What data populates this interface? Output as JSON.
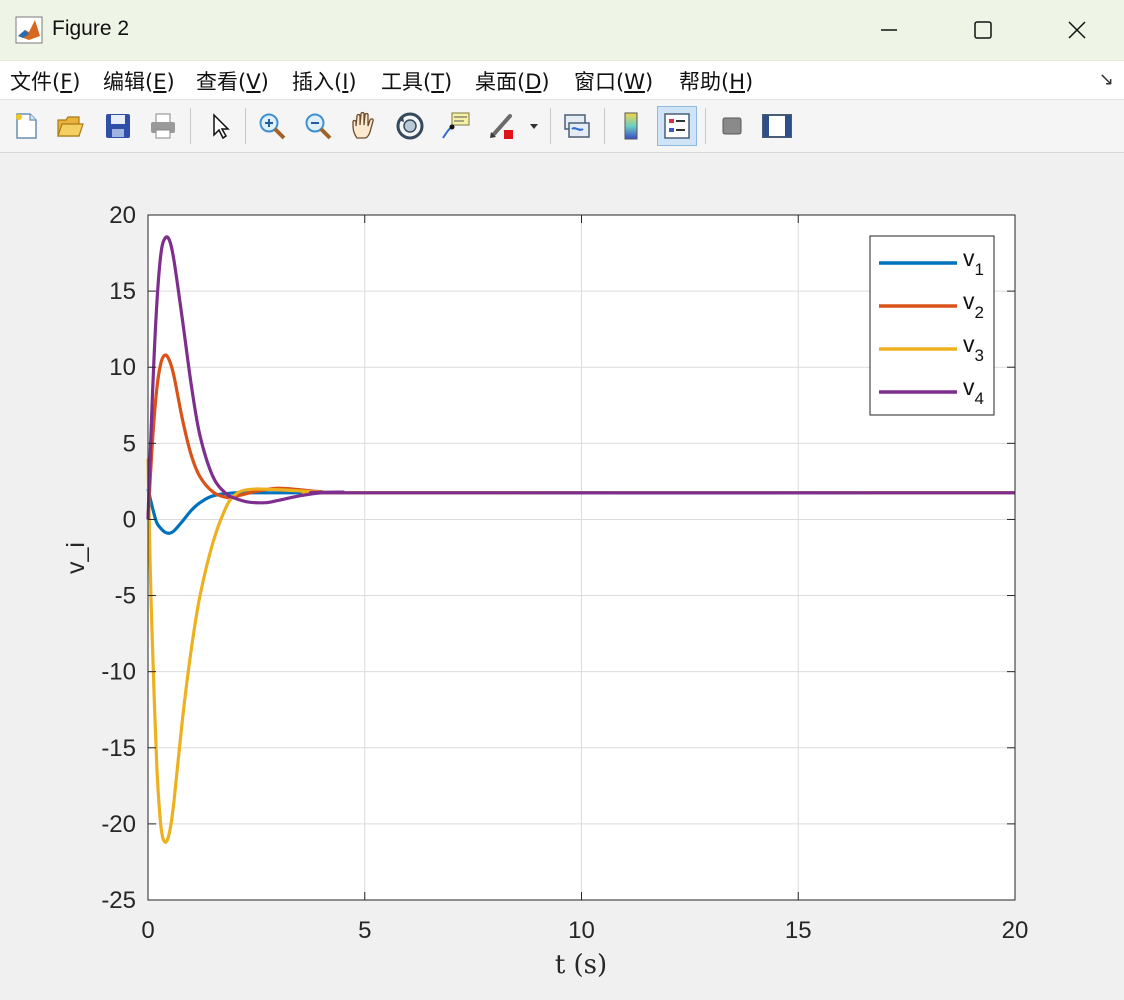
{
  "window": {
    "title": "Figure 2"
  },
  "menu": {
    "items": [
      {
        "label": "文件(",
        "key": "F",
        "suffix": ")"
      },
      {
        "label": "编辑(",
        "key": "E",
        "suffix": ")"
      },
      {
        "label": "查看(",
        "key": "V",
        "suffix": ")"
      },
      {
        "label": "插入(",
        "key": "I",
        "suffix": ")"
      },
      {
        "label": "工具(",
        "key": "T",
        "suffix": ")"
      },
      {
        "label": "桌面(",
        "key": "D",
        "suffix": ")"
      },
      {
        "label": "窗口(",
        "key": "W",
        "suffix": ")"
      },
      {
        "label": "帮助(",
        "key": "H",
        "suffix": ")"
      }
    ]
  },
  "toolbar": {
    "icons": [
      "new-figure-icon",
      "open-file-icon",
      "save-icon",
      "print-icon",
      "select-arrow-icon",
      "zoom-in-icon",
      "zoom-out-icon",
      "pan-hand-icon",
      "rotate-3d-icon",
      "data-cursor-icon",
      "brush-icon",
      "link-plot-icon",
      "colorbar-icon",
      "legend-icon",
      "hide-plot-tools-icon",
      "show-plot-tools-icon"
    ],
    "active": "legend-icon"
  },
  "chart_data": {
    "type": "line",
    "title": "",
    "xlabel": "t (s)",
    "ylabel": "v_i",
    "xlim": [
      0,
      20
    ],
    "ylim": [
      -25,
      20
    ],
    "xticks": [
      0,
      5,
      10,
      15,
      20
    ],
    "yticks": [
      -25,
      -20,
      -15,
      -10,
      -5,
      0,
      5,
      10,
      15,
      20
    ],
    "grid": true,
    "legend_position": "top-right",
    "series": [
      {
        "name": "v",
        "sub": "1",
        "color": "#0072BD",
        "x": [
          0,
          0.1,
          0.2,
          0.3,
          0.4,
          0.5,
          0.6,
          0.8,
          1.0,
          1.2,
          1.5,
          2.0,
          2.5,
          3.0,
          4.0,
          5.0,
          20
        ],
        "y": [
          2,
          0.8,
          -0.2,
          -0.6,
          -0.85,
          -0.9,
          -0.75,
          -0.1,
          0.6,
          1.1,
          1.55,
          1.75,
          1.75,
          1.75,
          1.75,
          1.75,
          1.75
        ]
      },
      {
        "name": "v",
        "sub": "2",
        "color": "#D95319",
        "x": [
          0,
          0.1,
          0.2,
          0.3,
          0.4,
          0.5,
          0.6,
          0.8,
          1.0,
          1.2,
          1.5,
          1.8,
          2.0,
          2.5,
          3.0,
          3.5,
          4.0,
          5.0,
          20
        ],
        "y": [
          0,
          5,
          8.5,
          10.3,
          10.8,
          10.4,
          9.4,
          6.5,
          4.2,
          2.8,
          1.8,
          1.45,
          1.5,
          1.85,
          2.05,
          1.95,
          1.82,
          1.75,
          1.75
        ]
      },
      {
        "name": "v",
        "sub": "3",
        "color": "#EDB120",
        "x": [
          0,
          0.05,
          0.1,
          0.2,
          0.3,
          0.4,
          0.5,
          0.6,
          0.8,
          1.0,
          1.2,
          1.5,
          1.8,
          2.0,
          2.2,
          2.5,
          3.0,
          4.0,
          5.0,
          20
        ],
        "y": [
          4,
          -3,
          -8,
          -16,
          -20.2,
          -21.2,
          -20.5,
          -18.5,
          -13,
          -8.5,
          -5,
          -1.5,
          0.8,
          1.6,
          1.9,
          2.0,
          1.95,
          1.8,
          1.75,
          1.75
        ]
      },
      {
        "name": "v",
        "sub": "4",
        "color": "#7E2F8E",
        "x": [
          0,
          0.1,
          0.2,
          0.3,
          0.4,
          0.5,
          0.6,
          0.8,
          1.0,
          1.2,
          1.5,
          1.8,
          2.0,
          2.3,
          2.7,
          3.0,
          3.5,
          4.0,
          4.5,
          5.0,
          20
        ],
        "y": [
          0,
          8,
          14,
          17.5,
          18.5,
          18.3,
          17,
          13,
          8.8,
          5.5,
          2.8,
          1.7,
          1.4,
          1.15,
          1.1,
          1.25,
          1.55,
          1.75,
          1.8,
          1.75,
          1.75
        ]
      }
    ]
  }
}
